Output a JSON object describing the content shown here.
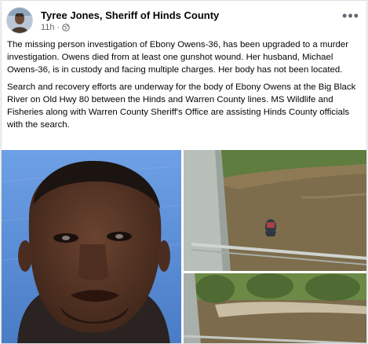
{
  "post": {
    "author": "Tyree Jones, Sheriff of Hinds County",
    "time": "11h",
    "separator": "·",
    "more_label": "•••",
    "paragraphs": [
      "The missing person investigation of Ebony Owens-36, has been upgraded to a murder investigation. Owens died from at least one gunshot wound. Her husband, Michael Owens-36, is in custody and facing multiple charges. Her body has not been located.",
      "Search and recovery efforts are underway for the body of Ebony Owens at the Big Black River on Old Hwy 80 between the Hinds and Warren County lines. MS Wildlife and Fisheries along with Warren County Sheriff's Office are assisting Hinds County officials with the search."
    ]
  },
  "icons": {
    "privacy": "globe-icon",
    "more": "more-options-icon"
  },
  "photos": [
    {
      "subject": "mugshot"
    },
    {
      "subject": "river-boat-from-bridge"
    },
    {
      "subject": "riverbank"
    }
  ],
  "colors": {
    "author_text": "#050505",
    "meta_text": "#65676b",
    "mugshot_bg": "#5b8fd6",
    "river": "#7d6d4c"
  }
}
